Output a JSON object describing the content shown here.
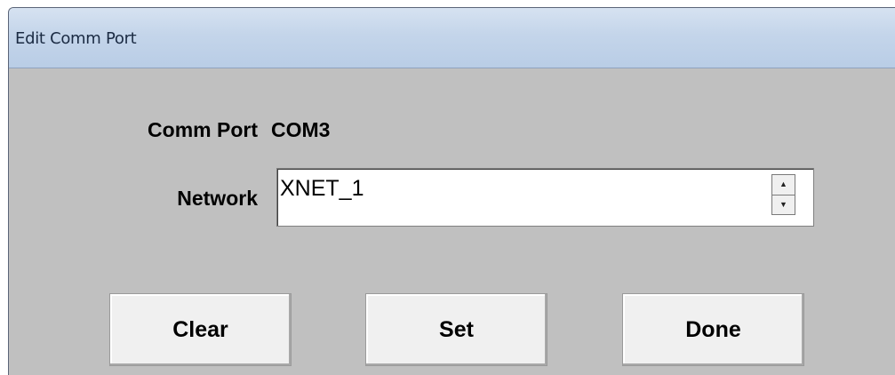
{
  "window": {
    "title": "Edit Comm Port"
  },
  "form": {
    "comm_port_label": "Comm Port",
    "comm_port_value": "COM3",
    "network_label": "Network",
    "network_value": "XNET_1"
  },
  "buttons": {
    "clear": "Clear",
    "set": "Set",
    "done": "Done"
  },
  "icons": {
    "spin_up": "spin-up-icon",
    "spin_down": "spin-down-icon"
  }
}
